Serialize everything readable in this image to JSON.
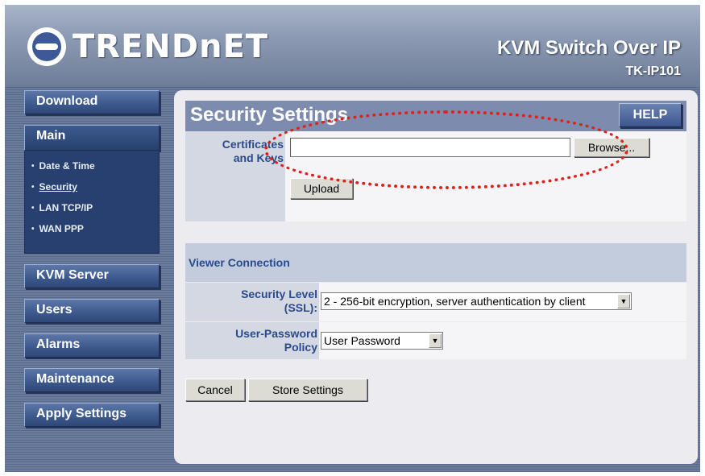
{
  "brand": {
    "logo_text": "TRENDnET"
  },
  "product": {
    "name": "KVM Switch Over IP",
    "model": "TK-IP101"
  },
  "sidebar": {
    "download": "Download",
    "main": "Main",
    "main_sub": [
      {
        "label": "Date & Time",
        "active": false
      },
      {
        "label": "Security",
        "active": true
      },
      {
        "label": "LAN TCP/IP",
        "active": false
      },
      {
        "label": "WAN PPP",
        "active": false
      }
    ],
    "kvm_server": "KVM Server",
    "users": "Users",
    "alarms": "Alarms",
    "maintenance": "Maintenance",
    "apply_settings": "Apply Settings"
  },
  "page": {
    "title": "Security Settings",
    "help": "HELP"
  },
  "certificates": {
    "label_line1": "Certificates",
    "label_line2": "and Keys",
    "file_value": "",
    "browse": "Browse...",
    "upload": "Upload"
  },
  "viewer": {
    "title": "Viewer Connection",
    "security_label_line1": "Security Level",
    "security_label_line2": "(SSL):",
    "security_value": "2 - 256-bit encryption, server authentication by client",
    "policy_label_line1": "User-Password",
    "policy_label_line2": "Policy",
    "policy_value": "User Password"
  },
  "actions": {
    "cancel": "Cancel",
    "store": "Store Settings"
  },
  "colors": {
    "annotation": "#e0201c",
    "accent": "#3e5a8e",
    "label_text": "#2a4a8c"
  }
}
